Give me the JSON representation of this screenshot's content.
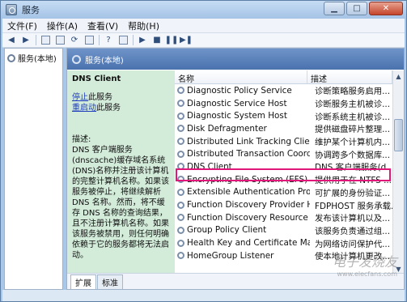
{
  "window": {
    "title": "服务"
  },
  "menu": [
    "文件(F)",
    "操作(A)",
    "查看(V)",
    "帮助(H)"
  ],
  "tree": {
    "item": "服务(本地)"
  },
  "main": {
    "header": "服务(本地)",
    "detail": {
      "service_name": "DNS Client",
      "stop_link": "停止",
      "stop_suffix": "此服务",
      "restart_link": "重启动",
      "restart_suffix": "此服务",
      "desc_label": "描述:",
      "desc": "DNS 客户端服务(dnscache)缓存域名系统(DNS)名称并注册该计算机的完整计算机名称。如果该服务被停止，将继续解析 DNS 名称。然而，将不缓存 DNS 名称的查询结果，且不注册计算机名称。如果该服务被禁用，则任何明确依赖于它的服务都将无法启动。"
    },
    "columns": {
      "name": "名称",
      "desc": "描述"
    },
    "services": [
      {
        "name": "Diagnostic Policy Service",
        "desc": "诊断策略服务启用..."
      },
      {
        "name": "Diagnostic Service Host",
        "desc": "诊断服务主机被诊..."
      },
      {
        "name": "Diagnostic System Host",
        "desc": "诊断系统主机被诊..."
      },
      {
        "name": "Disk Defragmenter",
        "desc": "提供磁盘碎片整理..."
      },
      {
        "name": "Distributed Link Tracking Client",
        "desc": "维护某个计算机内..."
      },
      {
        "name": "Distributed Transaction Coordi...",
        "desc": "协调跨多个数据库..."
      },
      {
        "name": "DNS Client",
        "desc": "DNS 客户端服务(d..."
      },
      {
        "name": "Encrypting File System (EFS)",
        "desc": "提供用于在 NTFS ..."
      },
      {
        "name": "Extensible Authentication Prot...",
        "desc": "可扩展的身份验证..."
      },
      {
        "name": "Function Discovery Provider H...",
        "desc": "FDPHOST 服务承载..."
      },
      {
        "name": "Function Discovery Resource P...",
        "desc": "发布该计算机以及..."
      },
      {
        "name": "Group Policy Client",
        "desc": "该服务负责通过组..."
      },
      {
        "name": "Health Key and Certificate Ma...",
        "desc": "为网络访问保护代..."
      },
      {
        "name": "HomeGroup Listener",
        "desc": "使本地计算机更改..."
      }
    ],
    "tabs": [
      "扩展",
      "标准"
    ]
  },
  "watermark": {
    "big": "电子发烧友",
    "small": "www.elecfans.com"
  }
}
